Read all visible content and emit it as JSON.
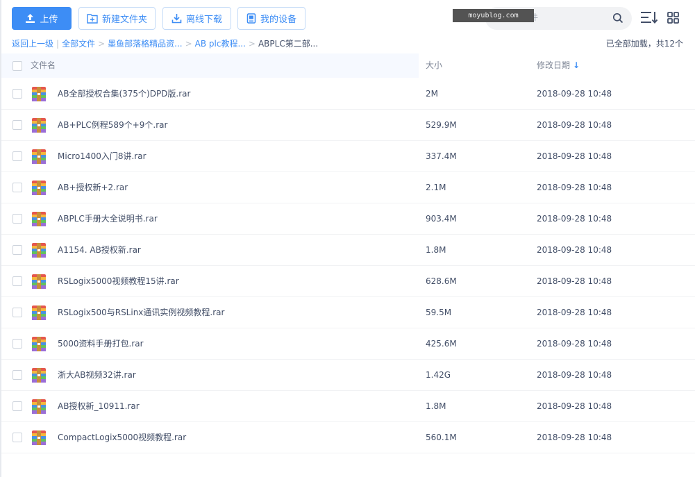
{
  "toolbar": {
    "upload_label": "上传",
    "new_folder_label": "新建文件夹",
    "offline_download_label": "离线下载",
    "my_devices_label": "我的设备"
  },
  "search": {
    "placeholder": "的文件",
    "watermark": "moyublog.com"
  },
  "breadcrumb": {
    "back": "返回上一级",
    "items": [
      "全部文件",
      "墨鱼部落格精品资...",
      "AB plc教程...",
      "ABPLC第二部..."
    ]
  },
  "status": "已全部加载，共12个",
  "table": {
    "headers": {
      "name": "文件名",
      "size": "大小",
      "date": "修改日期"
    },
    "sort_arrow": "↓",
    "rows": [
      {
        "name": "AB全部授权合集(375个)DPD版.rar",
        "size": "2M",
        "date": "2018-09-28 10:48"
      },
      {
        "name": "AB+PLC例程589个+9个.rar",
        "size": "529.9M",
        "date": "2018-09-28 10:48"
      },
      {
        "name": "Micro1400入门8讲.rar",
        "size": "337.4M",
        "date": "2018-09-28 10:48"
      },
      {
        "name": "AB+授权新+2.rar",
        "size": "2.1M",
        "date": "2018-09-28 10:48"
      },
      {
        "name": "ABPLC手册大全说明书.rar",
        "size": "903.4M",
        "date": "2018-09-28 10:48"
      },
      {
        "name": "A1154. AB授权新.rar",
        "size": "1.8M",
        "date": "2018-09-28 10:48"
      },
      {
        "name": "RSLogix5000视频教程15讲.rar",
        "size": "628.6M",
        "date": "2018-09-28 10:48"
      },
      {
        "name": "RSLogix500与RSLinx通讯实例视频教程.rar",
        "size": "59.5M",
        "date": "2018-09-28 10:48"
      },
      {
        "name": "5000资料手册打包.rar",
        "size": "425.6M",
        "date": "2018-09-28 10:48"
      },
      {
        "name": "浙大AB视频32讲.rar",
        "size": "1.42G",
        "date": "2018-09-28 10:48"
      },
      {
        "name": "AB授权新_10911.rar",
        "size": "1.8M",
        "date": "2018-09-28 10:48"
      },
      {
        "name": "CompactLogix5000视频教程.rar",
        "size": "560.1M",
        "date": "2018-09-28 10:48"
      }
    ]
  },
  "colors": {
    "accent": "#3d8df5",
    "text": "#424e67",
    "header_bg": "#f6f9ff",
    "search_bg": "#f1f2f4"
  },
  "icons": {
    "upload": "upload-icon",
    "new_folder": "new-folder-icon",
    "offline_download": "download-icon",
    "my_devices": "device-icon",
    "search": "search-icon",
    "sort": "sort-icon",
    "view": "grid-view-icon",
    "file": "rar-archive-icon"
  }
}
